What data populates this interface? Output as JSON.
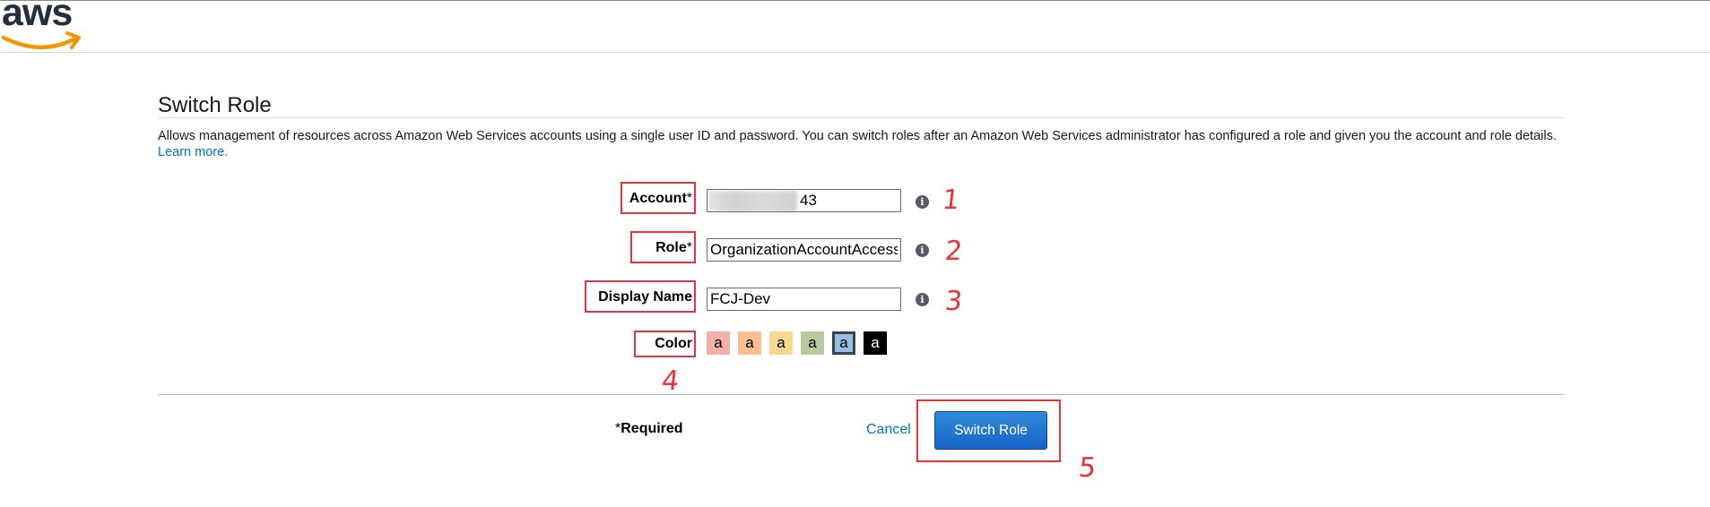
{
  "header": {
    "logo_text": "aws"
  },
  "page": {
    "title": "Switch Role",
    "description": "Allows management of resources across Amazon Web Services accounts using a single user ID and password. You can switch roles after an Amazon Web Services administrator has configured a role and given you the account and role details.",
    "learn_more": "Learn more."
  },
  "form": {
    "account": {
      "label": "Account",
      "required_mark": "*",
      "value_visible_suffix": "43",
      "info_icon": "info-icon"
    },
    "role": {
      "label": "Role",
      "required_mark": "*",
      "value": "OrganizationAccountAccess",
      "info_icon": "info-icon"
    },
    "display_name": {
      "label": "Display Name",
      "value": "FCJ-Dev",
      "info_icon": "info-icon"
    },
    "color": {
      "label": "Color",
      "swatches": [
        {
          "letter": "a",
          "color": "#f2b0a9"
        },
        {
          "letter": "a",
          "color": "#fbbf93"
        },
        {
          "letter": "a",
          "color": "#fad791"
        },
        {
          "letter": "a",
          "color": "#b7ca9d"
        },
        {
          "letter": "a",
          "color": "#99bce3",
          "selected": true
        },
        {
          "letter": "a",
          "color": "#000000",
          "text_color": "#ffffff"
        }
      ]
    }
  },
  "footer": {
    "required_note": "Required",
    "required_star": "*",
    "cancel_label": "Cancel",
    "submit_label": "Switch Role"
  },
  "annotations": {
    "n1": "1",
    "n2": "2",
    "n3": "3",
    "n4": "4",
    "n5": "5"
  },
  "colors": {
    "annotation_red": "#e8333a",
    "link_blue": "#0073bb",
    "button_blue": "#1f6fd0"
  }
}
